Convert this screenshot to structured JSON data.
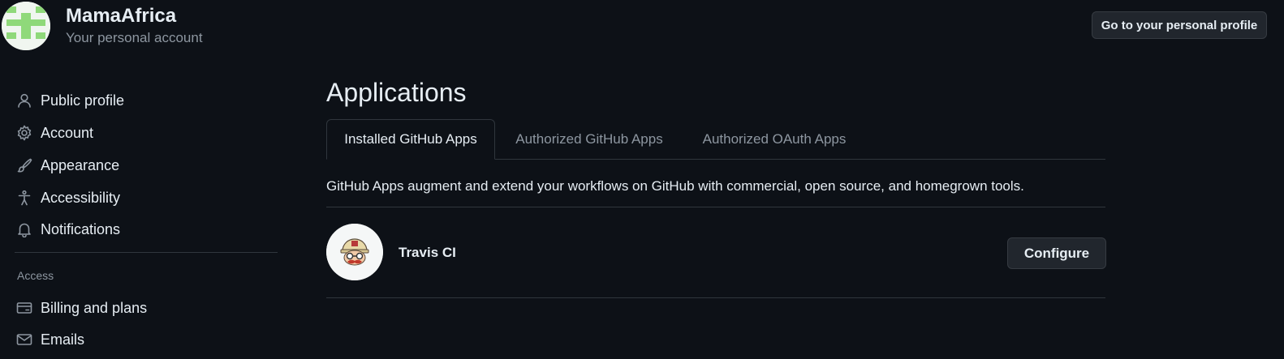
{
  "account": {
    "name": "MamaAfrica",
    "subtitle": "Your personal account",
    "profile_button": "Go to your personal profile"
  },
  "sidebar": {
    "items": [
      {
        "label": "Public profile",
        "icon": "person-icon"
      },
      {
        "label": "Account",
        "icon": "gear-icon"
      },
      {
        "label": "Appearance",
        "icon": "paintbrush-icon"
      },
      {
        "label": "Accessibility",
        "icon": "accessibility-icon"
      },
      {
        "label": "Notifications",
        "icon": "bell-icon"
      }
    ],
    "access_heading": "Access",
    "access_items": [
      {
        "label": "Billing and plans",
        "icon": "credit-card-icon"
      },
      {
        "label": "Emails",
        "icon": "mail-icon"
      }
    ]
  },
  "main": {
    "title": "Applications",
    "tabs": [
      {
        "label": "Installed GitHub Apps",
        "active": true
      },
      {
        "label": "Authorized GitHub Apps",
        "active": false
      },
      {
        "label": "Authorized OAuth Apps",
        "active": false
      }
    ],
    "intro": "GitHub Apps augment and extend your workflows on GitHub with commercial, open source, and homegrown tools.",
    "apps": [
      {
        "name": "Travis CI",
        "action": "Configure",
        "icon": "travis-ci-logo"
      }
    ]
  },
  "colors": {
    "background": "#0d1117",
    "text": "#e6edf3",
    "muted": "#8d96a0",
    "border": "#30363d",
    "button_bg": "#21262d"
  }
}
